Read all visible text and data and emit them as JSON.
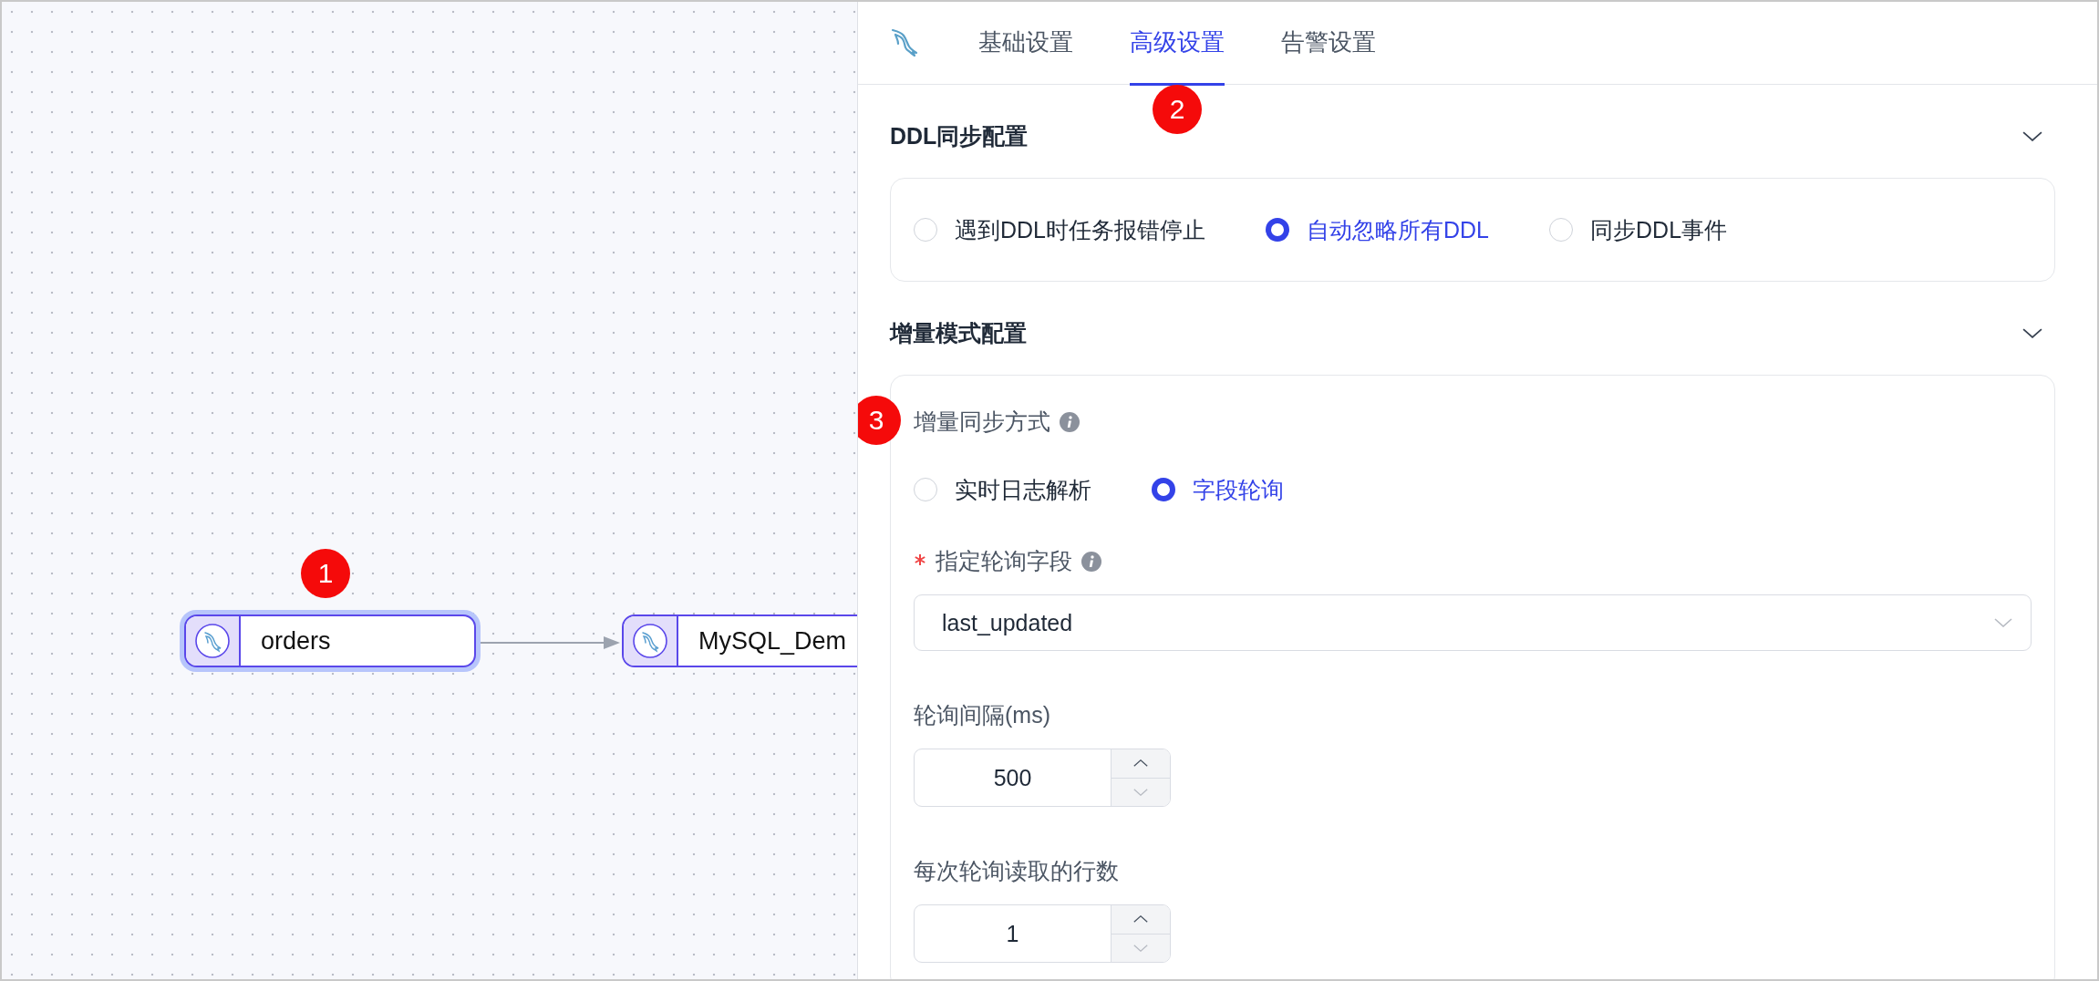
{
  "canvas": {
    "marker": "1",
    "nodes": [
      {
        "label": "orders",
        "selected": true
      },
      {
        "label": "MySQL_Dem",
        "selected": false
      }
    ]
  },
  "panel": {
    "tabs": [
      {
        "label": "基础设置",
        "selected": false
      },
      {
        "label": "高级设置",
        "selected": true,
        "marker": "2"
      },
      {
        "label": "告警设置",
        "selected": false
      }
    ],
    "sections": [
      {
        "title": "DDL同步配置",
        "expanded": true,
        "fields": [
          {
            "kind": "radio_group",
            "options": [
              {
                "label": "遇到DDL时任务报错停止",
                "selected": false
              },
              {
                "label": "自动忽略所有DDL",
                "selected": true
              },
              {
                "label": "同步DDL事件",
                "selected": false
              }
            ]
          }
        ]
      },
      {
        "title": "增量模式配置",
        "expanded": true,
        "fields": [
          {
            "kind": "radio_group",
            "label": "增量同步方式",
            "info": true,
            "marker": "3",
            "options": [
              {
                "label": "实时日志解析",
                "selected": false
              },
              {
                "label": "字段轮询",
                "selected": true
              }
            ]
          },
          {
            "kind": "select",
            "label": "指定轮询字段",
            "required": true,
            "info": true,
            "value": "last_updated"
          },
          {
            "kind": "number",
            "label": "轮询间隔(ms)",
            "value": "500"
          },
          {
            "kind": "number",
            "label": "每次轮询读取的行数",
            "value": "1"
          }
        ]
      }
    ]
  }
}
